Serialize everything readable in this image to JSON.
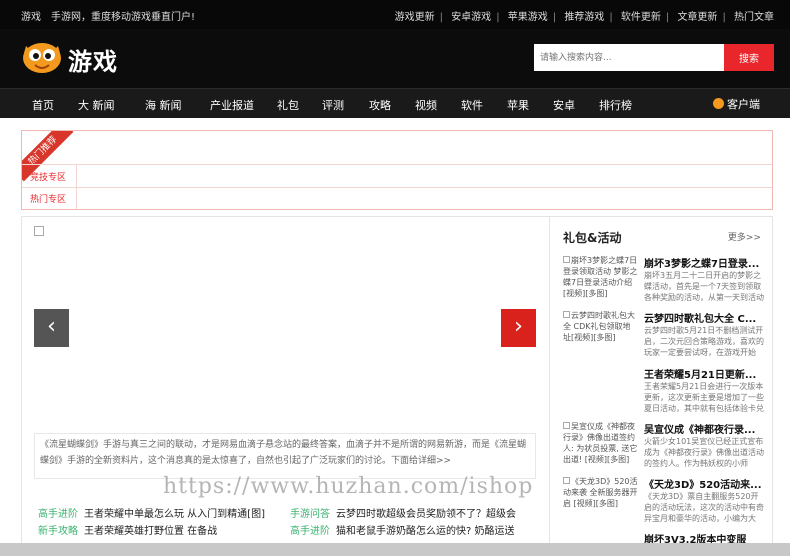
{
  "topbar": {
    "slogan_1": "游戏",
    "slogan_2": "手游网，重度移动游戏垂直门户!",
    "links": [
      "游戏更新",
      "安卓游戏",
      "苹果游戏",
      "推荐游戏",
      "软件更新",
      "文章更新",
      "热门文章"
    ]
  },
  "header": {
    "logo_text": "游戏",
    "search_placeholder": "请输入搜索内容...",
    "search_button": "搜索"
  },
  "nav": {
    "items": [
      "首页",
      "大 新闻",
      "海 新闻",
      "产业报道",
      "礼包",
      "评测",
      "攻略",
      "视频",
      "软件",
      "苹果",
      "安卓",
      "排行榜"
    ],
    "client": "客户端"
  },
  "hot": {
    "ribbon": "热门推荐",
    "row1": "竞技专区",
    "row2": "热门专区"
  },
  "slider": {
    "prev": "‹",
    "next": "›",
    "caption": "《流星蝴蝶剑》手游与真三之间的联动，才是网易血滴子悬念站的最终答案，血滴子并不是所谓的网易新游，而是《流星蝴蝶剑》手游的全新资料片，这个消息真的是太惊喜了，自然也引起了广泛玩家们的讨论。下面给详细>>"
  },
  "news": [
    {
      "tag": "高手进阶",
      "title": "王者荣耀中单最怎么玩 从入门到精通[图]"
    },
    {
      "tag": "手游问答",
      "title": "云梦四时歌超级会员奖励领不了？超级会"
    },
    {
      "tag": "新手攻略",
      "title": "王者荣耀英雄打野位置 在备战"
    },
    {
      "tag": "高手进阶",
      "title": "猫和老鼠手游奶酪怎么运的快? 奶酪运送"
    }
  ],
  "sidebar": {
    "title": "礼包&活动",
    "more": "更多>>",
    "items": [
      {
        "thumb": "崩坏3梦影之蝶7日登录领取活动 梦影之蝶7日登录活动介绍[视频][多图]",
        "title": "崩坏3梦影之蝶7日登录...",
        "desc": "崩坏3五月二十二日开启的梦影之蝶活动，首先是一个7天签到领取各种奖励的活动，从第一天到活动"
      },
      {
        "thumb": "云梦四时歌礼包大全 CDK礼包领取地址[视频][多图]",
        "title": "云梦四时歌礼包大全 C...",
        "desc": "云梦四时歌5月21日不删档测试开启，二次元回合策略游戏，喜欢的玩家一定要尝试呀，在游戏开始"
      },
      {
        "thumb": "",
        "title": "王者荣耀5月21日更新...",
        "desc": "王者荣耀5月21日会进行一次版本更新，这次更新主要是增加了一些夏日活动，其中就有包括体验卡兑"
      },
      {
        "thumb": "吴宣仪成《神都夜行录》佛像出道签约人: 为状员投票, 送它出道! [视频][多图]",
        "title": "吴宣仪成《神都夜行录...",
        "desc": "火箭少女101吴宣仪已经正式宣布成为《神都夜行录》佛像出道活动的签约人。作为韩妖权的小师"
      },
      {
        "thumb": "《天龙3D》520活动来袭 全新服务器开启 [视频][多图]",
        "title": "《天龙3D》520活动来...",
        "desc": "《天龙3D》票自主翻服务520开启的活动玩法，这次的活动中有奇异宝月和豪华的活动，小编为大"
      }
    ],
    "bottom": "崩坏3V3.2版本中变服"
  },
  "watermark": "https://www.huzhan.com/ishop"
}
